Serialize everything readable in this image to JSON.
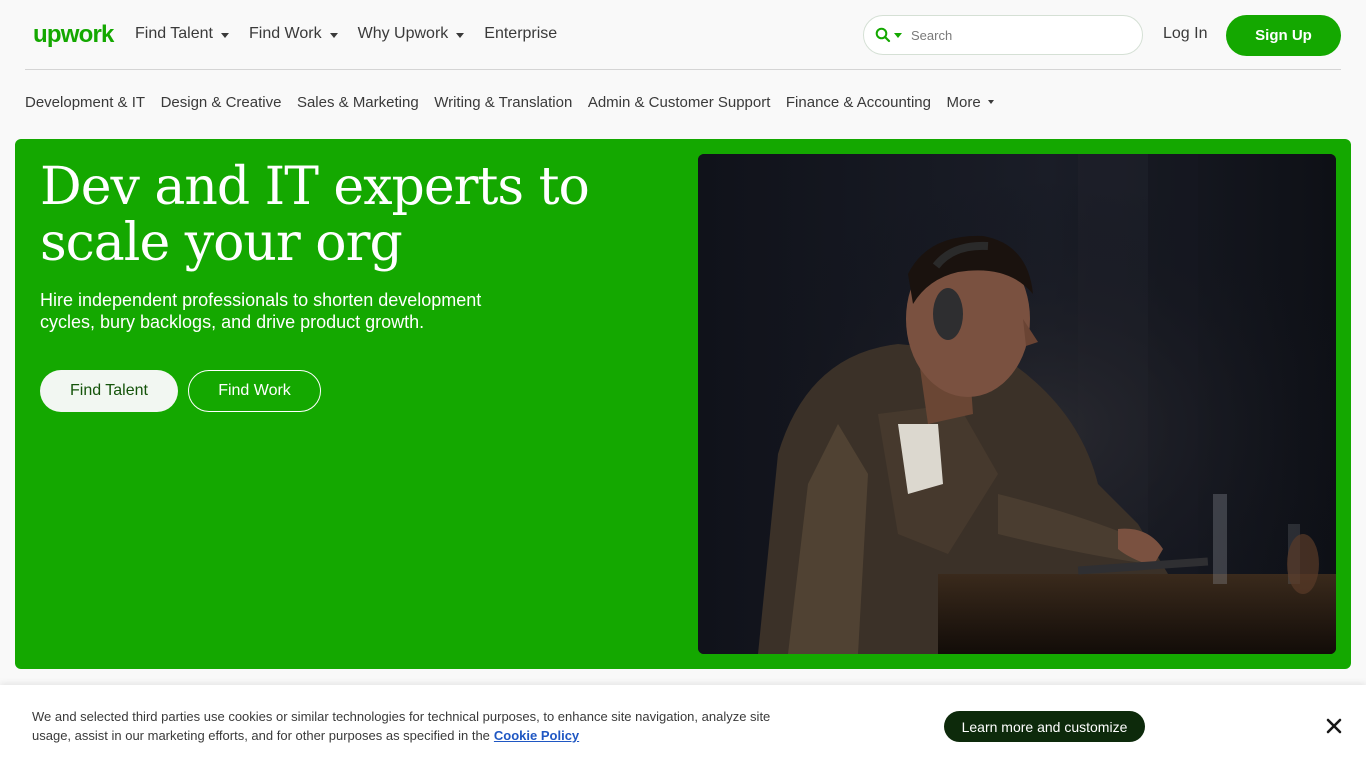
{
  "header": {
    "logo": "upwork",
    "nav": [
      {
        "label": "Find Talent",
        "dropdown": true
      },
      {
        "label": "Find Work",
        "dropdown": true
      },
      {
        "label": "Why Upwork",
        "dropdown": true
      },
      {
        "label": "Enterprise",
        "dropdown": false
      }
    ],
    "search_placeholder": "Search",
    "login_label": "Log In",
    "signup_label": "Sign Up"
  },
  "categories": [
    "Development & IT",
    "Design & Creative",
    "Sales & Marketing",
    "Writing & Translation",
    "Admin & Customer Support",
    "Finance & Accounting",
    "More"
  ],
  "hero": {
    "title": "Dev and IT experts to scale your org",
    "subtitle": "Hire independent professionals to shorten development cycles, bury backlogs, and drive product growth.",
    "primary_button": "Find Talent",
    "secondary_button": "Find Work",
    "image_icon": "developer-photo"
  },
  "cookie_banner": {
    "text": "We and selected third parties use cookies or similar technologies for technical purposes, to enhance site navigation, analyze site usage, assist in our marketing efforts, and for other purposes as specified in the",
    "link_label": "Cookie Policy",
    "button_label": "Learn more and customize"
  },
  "colors": {
    "brand": "#14a800",
    "dark_button": "#0d2a0b",
    "link": "#1f57c3"
  }
}
